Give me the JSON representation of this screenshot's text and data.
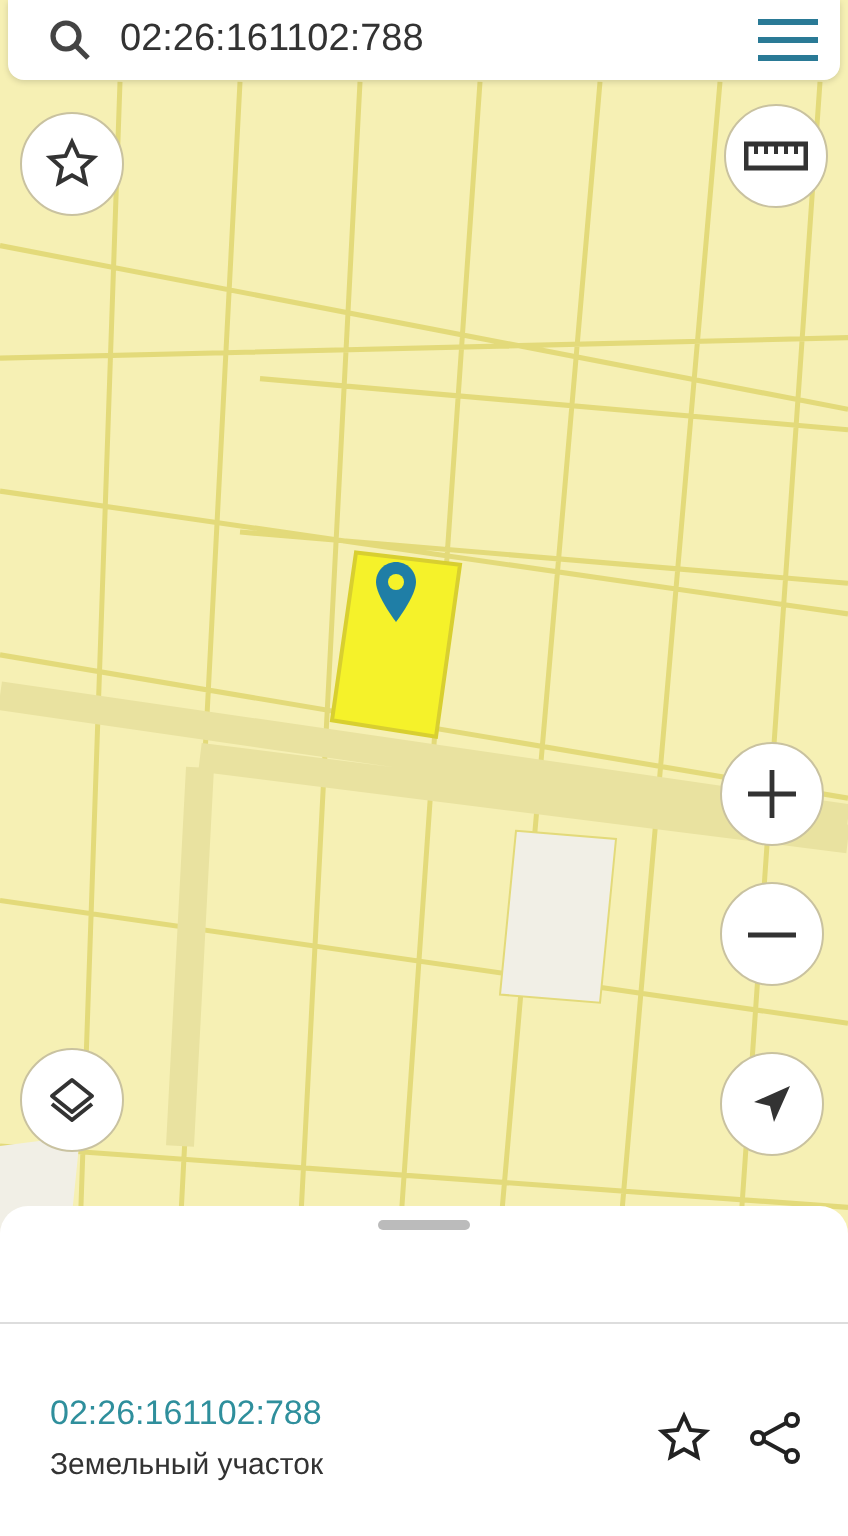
{
  "search": {
    "value": "02:26:161102:788"
  },
  "selection": {
    "cadastral_number": "02:26:161102:788",
    "type": "Земельный участок",
    "favorite": false
  }
}
